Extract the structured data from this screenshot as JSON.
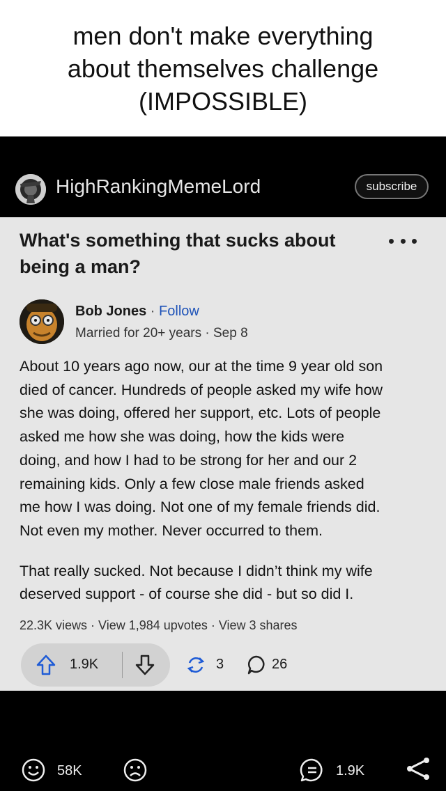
{
  "caption": "men don't make everything\nabout themselves challenge\n(IMPOSSIBLE)",
  "channel": {
    "name": "HighRankingMemeLord",
    "subscribe_label": "subscribe"
  },
  "post": {
    "question": "What's something that sucks about\nbeing a man?",
    "author": {
      "name": "Bob Jones",
      "separator": " · ",
      "follow_label": "Follow",
      "meta": "Married for 20+ years · Sep 8"
    },
    "paragraphs": [
      "About 10 years ago now, our at the time 9 year old son\ndied of cancer. Hundreds of people asked my wife how\nshe was doing, offered her support, etc. Lots of people\nasked me how she was doing, how the kids were\ndoing, and how I had to be strong for her and our 2\nremaining kids. Only a few close male friends asked\nme how I was doing. Not one of my female friends did.\nNot even my mother. Never occurred to them.",
      "That really sucked. Not because I didn’t think my wife\ndeserved support - of course she did - but so did I."
    ],
    "stats": "22.3K views · View 1,984 upvotes · View 3 shares",
    "upvotes": "1.9K",
    "shares": "3",
    "comments": "26"
  },
  "bottom_bar": {
    "reactions": "58K",
    "comments": "1.9K"
  },
  "icons": {
    "upvote": "arrow-up-outline",
    "downvote": "arrow-down-outline",
    "share": "circular-arrows",
    "comment": "speech-bubble",
    "smile": "smiley-face",
    "frown": "frowning-face",
    "chat": "speech-bubble-lines",
    "share_bottom": "share-nodes"
  },
  "colors": {
    "card_background": "#e6e6e6",
    "follow_link": "#1d52b8",
    "page_background": "#000000"
  }
}
